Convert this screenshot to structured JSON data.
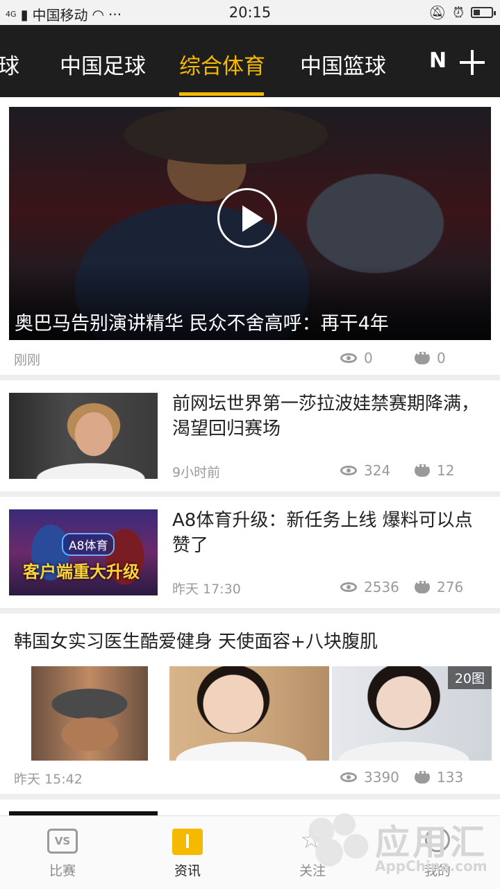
{
  "status_bar": {
    "signal_text": "4G",
    "carrier": "中国移动",
    "more": "···",
    "time": "20:15"
  },
  "top_nav": {
    "tabs": [
      {
        "label": "足球",
        "active": false
      },
      {
        "label": "中国足球",
        "active": false
      },
      {
        "label": "综合体育",
        "active": true
      },
      {
        "label": "中国篮球",
        "active": false
      }
    ],
    "more_label": "N",
    "accent_color": "#f5b900"
  },
  "feed": {
    "hero": {
      "title": "奥巴马告别演讲精华 民众不舍高呼：再干4年",
      "time": "刚刚",
      "views": "0",
      "comments": "0"
    },
    "items": [
      {
        "title": "前网坛世界第一莎拉波娃禁赛期降满，渴望回归赛场",
        "time": "9小时前",
        "views": "324",
        "comments": "12"
      },
      {
        "title": "A8体育升级：新任务上线 爆料可以点赞了",
        "time": "昨天 17:30",
        "views": "2536",
        "comments": "276",
        "thumb_badge": "A8体育",
        "thumb_caption": "客户端重大升级"
      }
    ],
    "gallery": {
      "title": "韩国女实习医生酷爱健身 天使面容+八块腹肌",
      "image_count": "20图",
      "time": "昨天 15:42",
      "views": "3390",
      "comments": "133"
    }
  },
  "tab_bar": {
    "items": [
      {
        "label": "比赛",
        "icon": "vs-icon",
        "active": false
      },
      {
        "label": "资讯",
        "icon": "news-icon",
        "active": true
      },
      {
        "label": "关注",
        "icon": "star-icon",
        "active": false
      },
      {
        "label": "我的",
        "icon": "user-icon",
        "active": false
      }
    ]
  },
  "watermark": {
    "cn": "应用汇",
    "en": "AppChina.com"
  }
}
